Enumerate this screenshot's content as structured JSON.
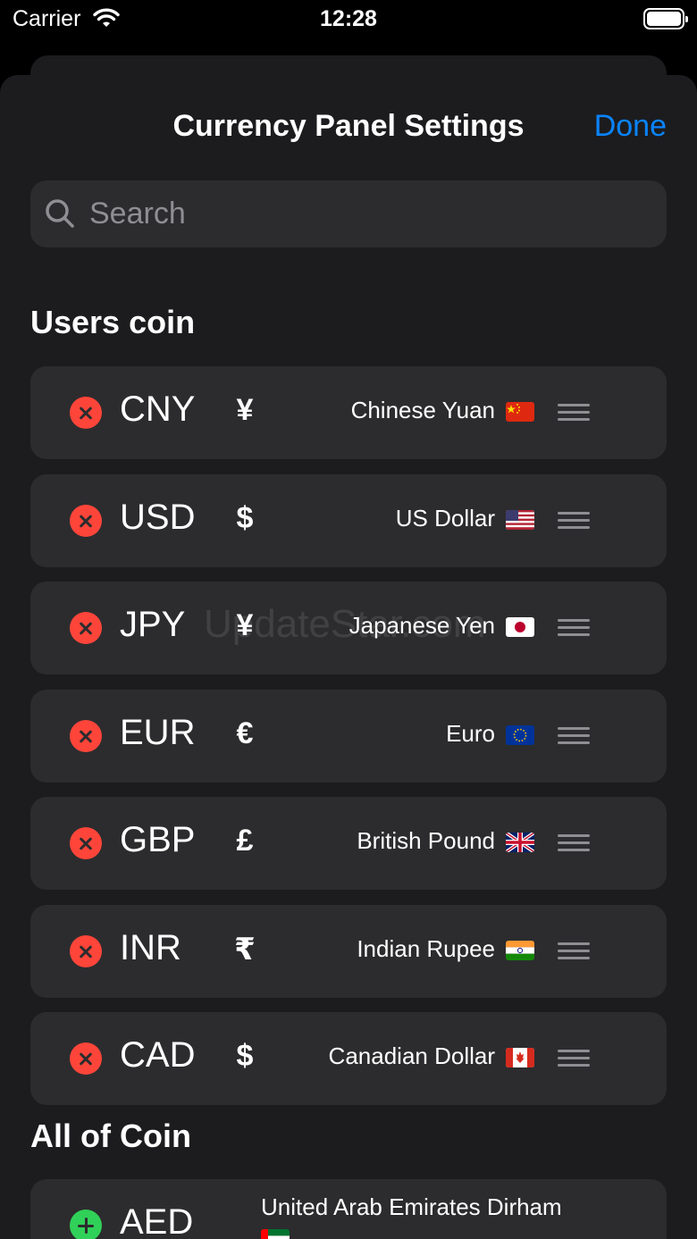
{
  "status_bar": {
    "carrier": "Carrier",
    "time": "12:28"
  },
  "nav": {
    "title": "Currency Panel Settings",
    "done_label": "Done"
  },
  "search": {
    "placeholder": "Search"
  },
  "sections": {
    "users_coin": "Users coin",
    "all_coin": "All of Coin"
  },
  "users_coins": [
    {
      "code": "CNY",
      "symbol": "¥",
      "name": "Chinese Yuan",
      "flag": "china-flag-icon"
    },
    {
      "code": "USD",
      "symbol": "$",
      "name": "US Dollar",
      "flag": "us-flag-icon"
    },
    {
      "code": "JPY",
      "symbol": "¥",
      "name": "Japanese Yen",
      "flag": "japan-flag-icon"
    },
    {
      "code": "EUR",
      "symbol": "€",
      "name": "Euro",
      "flag": "eu-flag-icon"
    },
    {
      "code": "GBP",
      "symbol": "£",
      "name": "British Pound",
      "flag": "uk-flag-icon"
    },
    {
      "code": "INR",
      "symbol": "₹",
      "name": "Indian Rupee",
      "flag": "india-flag-icon"
    },
    {
      "code": "CAD",
      "symbol": "$",
      "name": "Canadian Dollar",
      "flag": "canada-flag-icon"
    }
  ],
  "all_coins": [
    {
      "code": "AED",
      "name": "United Arab Emirates Dirham",
      "flag": "uae-flag-icon"
    }
  ],
  "watermark": "UpdateStar.com",
  "colors": {
    "accent": "#0a84ff",
    "remove": "#ff453a",
    "add": "#30d158",
    "card": "#2c2c2e",
    "sheet": "#1c1c1e"
  }
}
